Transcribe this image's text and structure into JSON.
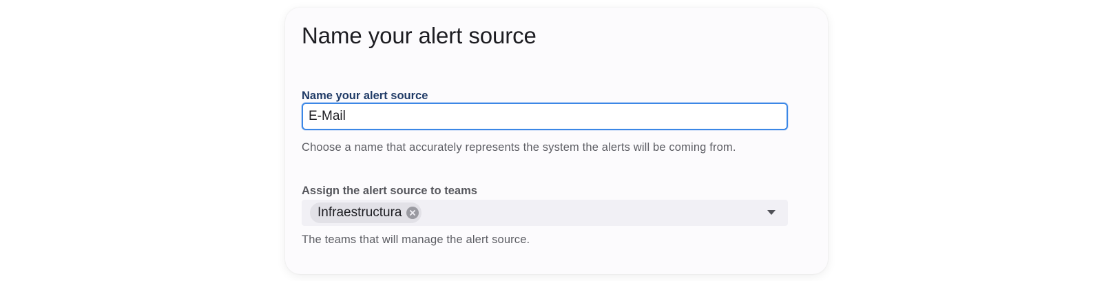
{
  "form": {
    "title": "Name your alert source",
    "name_field": {
      "label": "Name your alert source",
      "value": "E-Mail",
      "help": "Choose a name that accurately represents the system the alerts will be coming from."
    },
    "teams_field": {
      "label": "Assign the alert source to teams",
      "selected": [
        {
          "label": "Infraestructura",
          "remove_icon": "close-circle-icon"
        }
      ],
      "dropdown_icon": "chevron-down-icon",
      "help": "The teams that will manage the alert source."
    }
  },
  "colors": {
    "focus_border": "#3b87e6",
    "label_active": "#1f3a66",
    "label_muted": "#55565c",
    "card_background": "#fcfbfd",
    "chip_background": "#e2e1e7",
    "select_background": "#f1f0f5"
  }
}
